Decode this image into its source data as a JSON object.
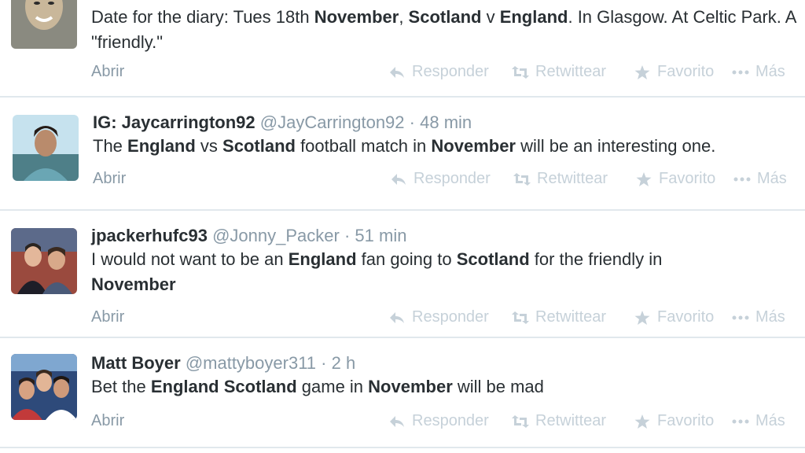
{
  "tweets": [
    {
      "name": "",
      "handle": "",
      "time": "",
      "text_parts": [
        [
          "Date for the diary: Tues 18th ",
          false
        ],
        [
          "November",
          true
        ],
        [
          ", ",
          false
        ],
        [
          "Scotland",
          true
        ],
        [
          " v ",
          false
        ],
        [
          "England",
          true
        ],
        [
          ". In Glasgow. At Celtic Park. A \"friendly.\"",
          false
        ]
      ],
      "avatar_icon": "avatar-photo"
    },
    {
      "name": "IG: Jaycarrington92",
      "handle": "@JayCarrington92",
      "time": "48 min",
      "text_parts": [
        [
          "The ",
          false
        ],
        [
          "England",
          true
        ],
        [
          " vs ",
          false
        ],
        [
          "Scotland",
          true
        ],
        [
          " football match in ",
          false
        ],
        [
          "November",
          true
        ],
        [
          " will be an interesting one.",
          false
        ]
      ],
      "avatar_icon": "avatar-photo"
    },
    {
      "name": "jpackerhufc93",
      "handle": "@Jonny_Packer",
      "time": "51 min",
      "text_parts": [
        [
          "I would not want to be an ",
          false
        ],
        [
          "England",
          true
        ],
        [
          " fan going to ",
          false
        ],
        [
          "Scotland",
          true
        ],
        [
          " for the friendly in ",
          false
        ],
        [
          "November",
          true
        ]
      ],
      "avatar_icon": "avatar-photo"
    },
    {
      "name": "Matt Boyer",
      "handle": "@mattyboyer311",
      "time": "2 h",
      "text_parts": [
        [
          "Bet the ",
          false
        ],
        [
          "England",
          true
        ],
        [
          " ",
          false
        ],
        [
          "Scotland",
          true
        ],
        [
          " game in ",
          false
        ],
        [
          "November",
          true
        ],
        [
          " will be mad",
          false
        ]
      ],
      "avatar_icon": "avatar-photo"
    }
  ],
  "actions": {
    "open": "Abrir",
    "reply": "Responder",
    "retweet": "Retwittear",
    "favorite": "Favorito",
    "more": "Más",
    "icons": [
      "reply-icon",
      "retweet-icon",
      "star-icon",
      "more-dots-icon"
    ]
  },
  "separator": "·",
  "colors": {
    "text": "#292f33",
    "muted": "#8899a6",
    "faint": "#c6d1d9",
    "divider": "#e1e8ed"
  }
}
